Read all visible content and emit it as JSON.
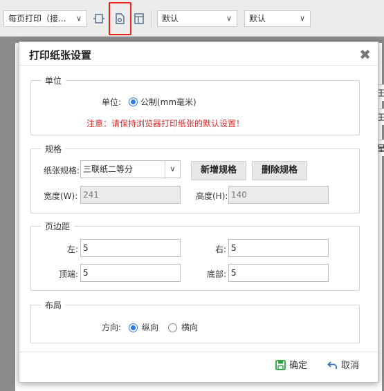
{
  "toolbar": {
    "print_mode": "每页打印（接...",
    "select2": "默认",
    "select3": "默认",
    "icons": [
      "page-layout-icon",
      "paper-settings-icon",
      "page-margin-icon"
    ]
  },
  "background": {
    "fragments": [
      "王",
      "王",
      "星"
    ]
  },
  "dialog": {
    "title": "打印纸张设置",
    "close_symbol": "✖",
    "unit": {
      "legend": "单位",
      "label": "单位:",
      "option": "公制(mm毫米)",
      "warning": "注意：请保持浏览器打印纸张的默认设置！"
    },
    "spec": {
      "legend": "规格",
      "paper_label": "纸张规格:",
      "paper_value": "三联纸二等分",
      "add_button": "新增规格",
      "delete_button": "删除规格",
      "width_label": "宽度(W):",
      "width_value": "241",
      "height_label": "高度(H):",
      "height_value": "140"
    },
    "margin": {
      "legend": "页边距",
      "left_label": "左:",
      "left_value": "5",
      "right_label": "右:",
      "right_value": "5",
      "top_label": "顶端:",
      "top_value": "5",
      "bottom_label": "底部:",
      "bottom_value": "5"
    },
    "layout": {
      "legend": "布局",
      "direction_label": "方向:",
      "portrait": "纵向",
      "landscape": "横向",
      "selected": "纵向"
    },
    "footer": {
      "ok": "确定",
      "cancel": "取消"
    }
  },
  "colors": {
    "accent": "#2d7be3",
    "warning": "#d92b2b",
    "highlight": "#e8231d",
    "ok_icon": "#2e9e3f",
    "cancel_icon": "#2f6fb8"
  }
}
